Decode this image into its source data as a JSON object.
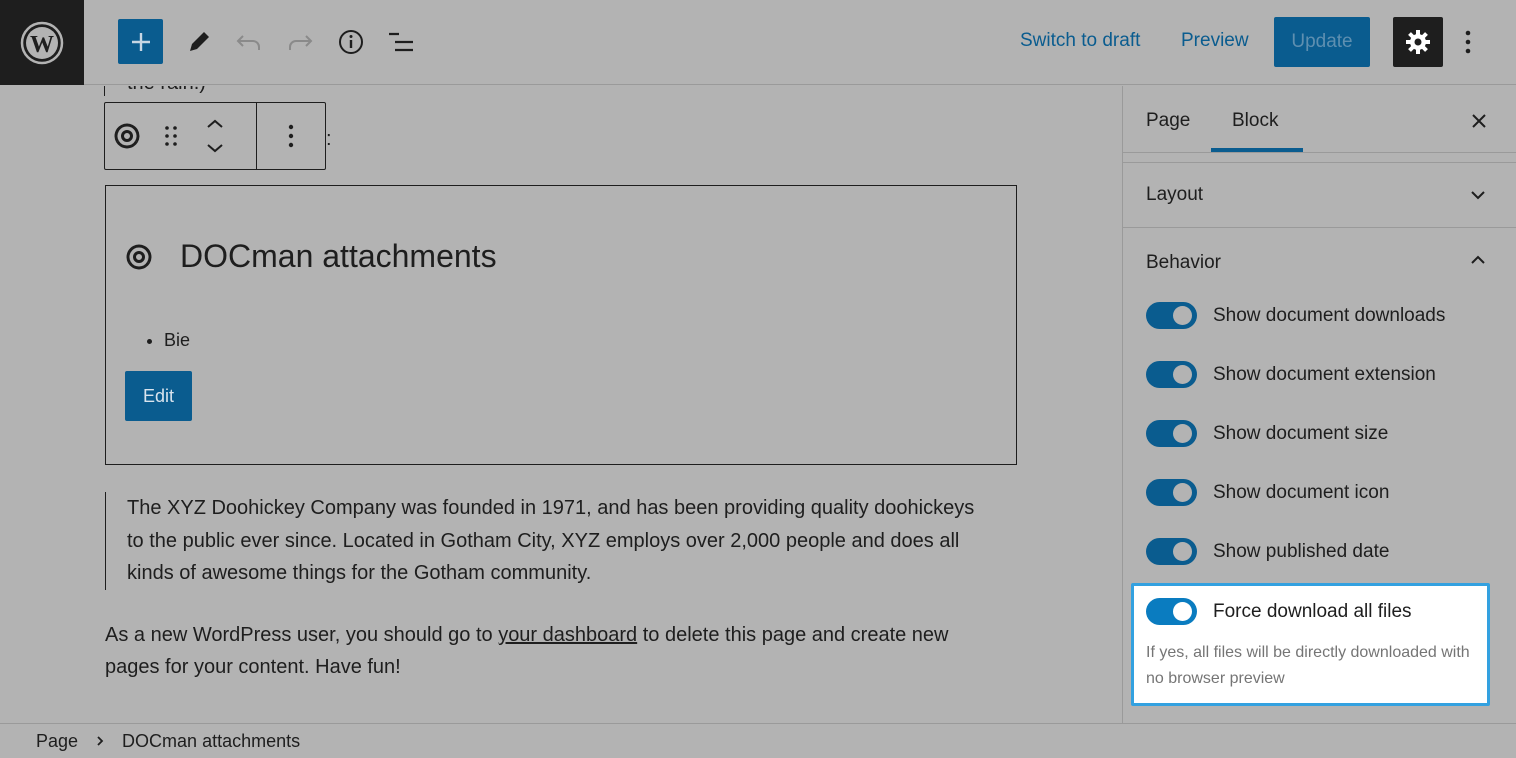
{
  "header": {
    "switch_to_draft": "Switch to draft",
    "preview": "Preview",
    "update": "Update"
  },
  "canvas": {
    "cut_text": "the rain.)",
    "peek_colon": ":",
    "docman_block": {
      "title": "DOCman attachments",
      "list_items": [
        "Bie"
      ],
      "edit_label": "Edit"
    },
    "quote": "The XYZ Doohickey Company was founded in 1971, and has been providing quality doohickeys to the public ever since. Located in Gotham City, XYZ employs over 2,000 people and does all kinds of awesome things for the Gotham community.",
    "para_before": "As a new WordPress user, you should go to ",
    "para_link": "your dashboard",
    "para_after": " to delete this page and create new pages for your content. Have fun!"
  },
  "sidebar": {
    "tabs": [
      {
        "label": "Page",
        "active": false
      },
      {
        "label": "Block",
        "active": true
      }
    ],
    "layout_title": "Layout",
    "behavior_title": "Behavior",
    "toggles": [
      {
        "label": "Show document downloads",
        "on": true
      },
      {
        "label": "Show document extension",
        "on": true
      },
      {
        "label": "Show document size",
        "on": true
      },
      {
        "label": "Show document icon",
        "on": true
      },
      {
        "label": "Show published date",
        "on": true
      }
    ],
    "force_download": {
      "label": "Force download all files",
      "on": true,
      "help": "If yes, all files will be directly downloaded with no browser preview"
    }
  },
  "footer": {
    "breadcrumb": [
      "Page",
      "DOCman attachments"
    ]
  },
  "colors": {
    "accent": "#0a5c8f",
    "focus": "#33a1e0",
    "overlay": "#b3b3b3"
  }
}
